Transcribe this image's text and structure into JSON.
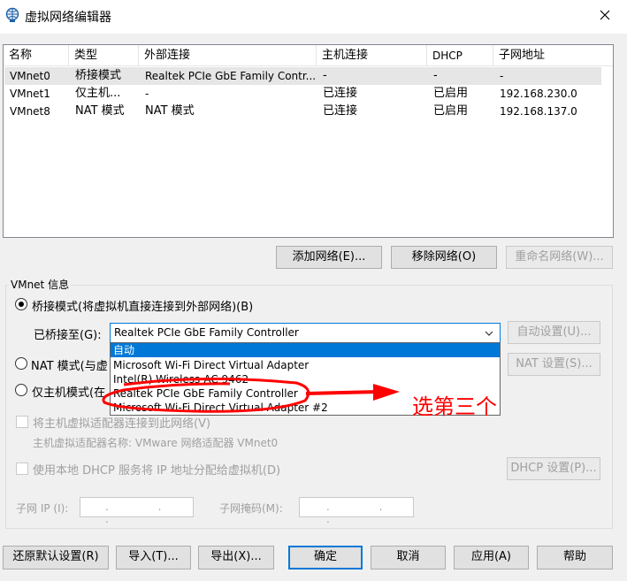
{
  "window": {
    "title": "虚拟网络编辑器"
  },
  "table": {
    "headers": [
      "名称",
      "类型",
      "外部连接",
      "主机连接",
      "DHCP",
      "子网地址"
    ],
    "rows": [
      [
        "VMnet0",
        "桥接模式",
        "Realtek PCIe GbE Family Contr...",
        "-",
        "-",
        "-"
      ],
      [
        "VMnet1",
        "仅主机...",
        "-",
        "已连接",
        "已启用",
        "192.168.230.0"
      ],
      [
        "VMnet8",
        "NAT 模式",
        "NAT 模式",
        "已连接",
        "已启用",
        "192.168.137.0"
      ]
    ]
  },
  "table_buttons": {
    "add": "添加网络(E)...",
    "remove": "移除网络(O)",
    "rename": "重命名网络(W)..."
  },
  "vmnet_info": {
    "group_label": "VMnet 信息",
    "bridge_radio": "桥接模式(将虚拟机直接连接到外部网络)(B)",
    "bridged_to_label": "已桥接至(G):",
    "bridged_to_value": "Realtek PCIe GbE Family Controller",
    "auto_settings": "自动设置(U)...",
    "nat_radio": "NAT 模式(与虚",
    "nat_settings": "NAT 设置(S)...",
    "hostonly_radio": "仅主机模式(在",
    "connect_host_adapter": "将主机虚拟适配器连接到此网络(V)",
    "host_adapter_name": "主机虚拟适配器名称: VMware 网络适配器 VMnet0",
    "use_dhcp": "使用本地 DHCP 服务将 IP 地址分配给虚拟机(D)",
    "dhcp_settings": "DHCP 设置(P)...",
    "subnet_ip_label": "子网 IP (I):",
    "subnet_mask_label": "子网掩码(M):",
    "ip_dots": ". . ."
  },
  "dropdown": {
    "options": [
      "自动",
      "Microsoft Wi-Fi Direct Virtual Adapter",
      "Intel(R) Wireless-AC 9462",
      "Realtek PCIe GbE Family Controller",
      "Microsoft Wi-Fi Direct Virtual Adapter #2"
    ]
  },
  "annotation": {
    "text": "选第三个",
    "color": "#ff0000"
  },
  "footer": {
    "restore": "还原默认设置(R)",
    "import": "导入(T)...",
    "export": "导出(X)...",
    "ok": "确定",
    "cancel": "取消",
    "apply": "应用(A)",
    "help": "帮助"
  },
  "colors": {
    "accent": "#0078d7",
    "selection": "#0078d7",
    "disabled_text": "#a0a0a0"
  }
}
